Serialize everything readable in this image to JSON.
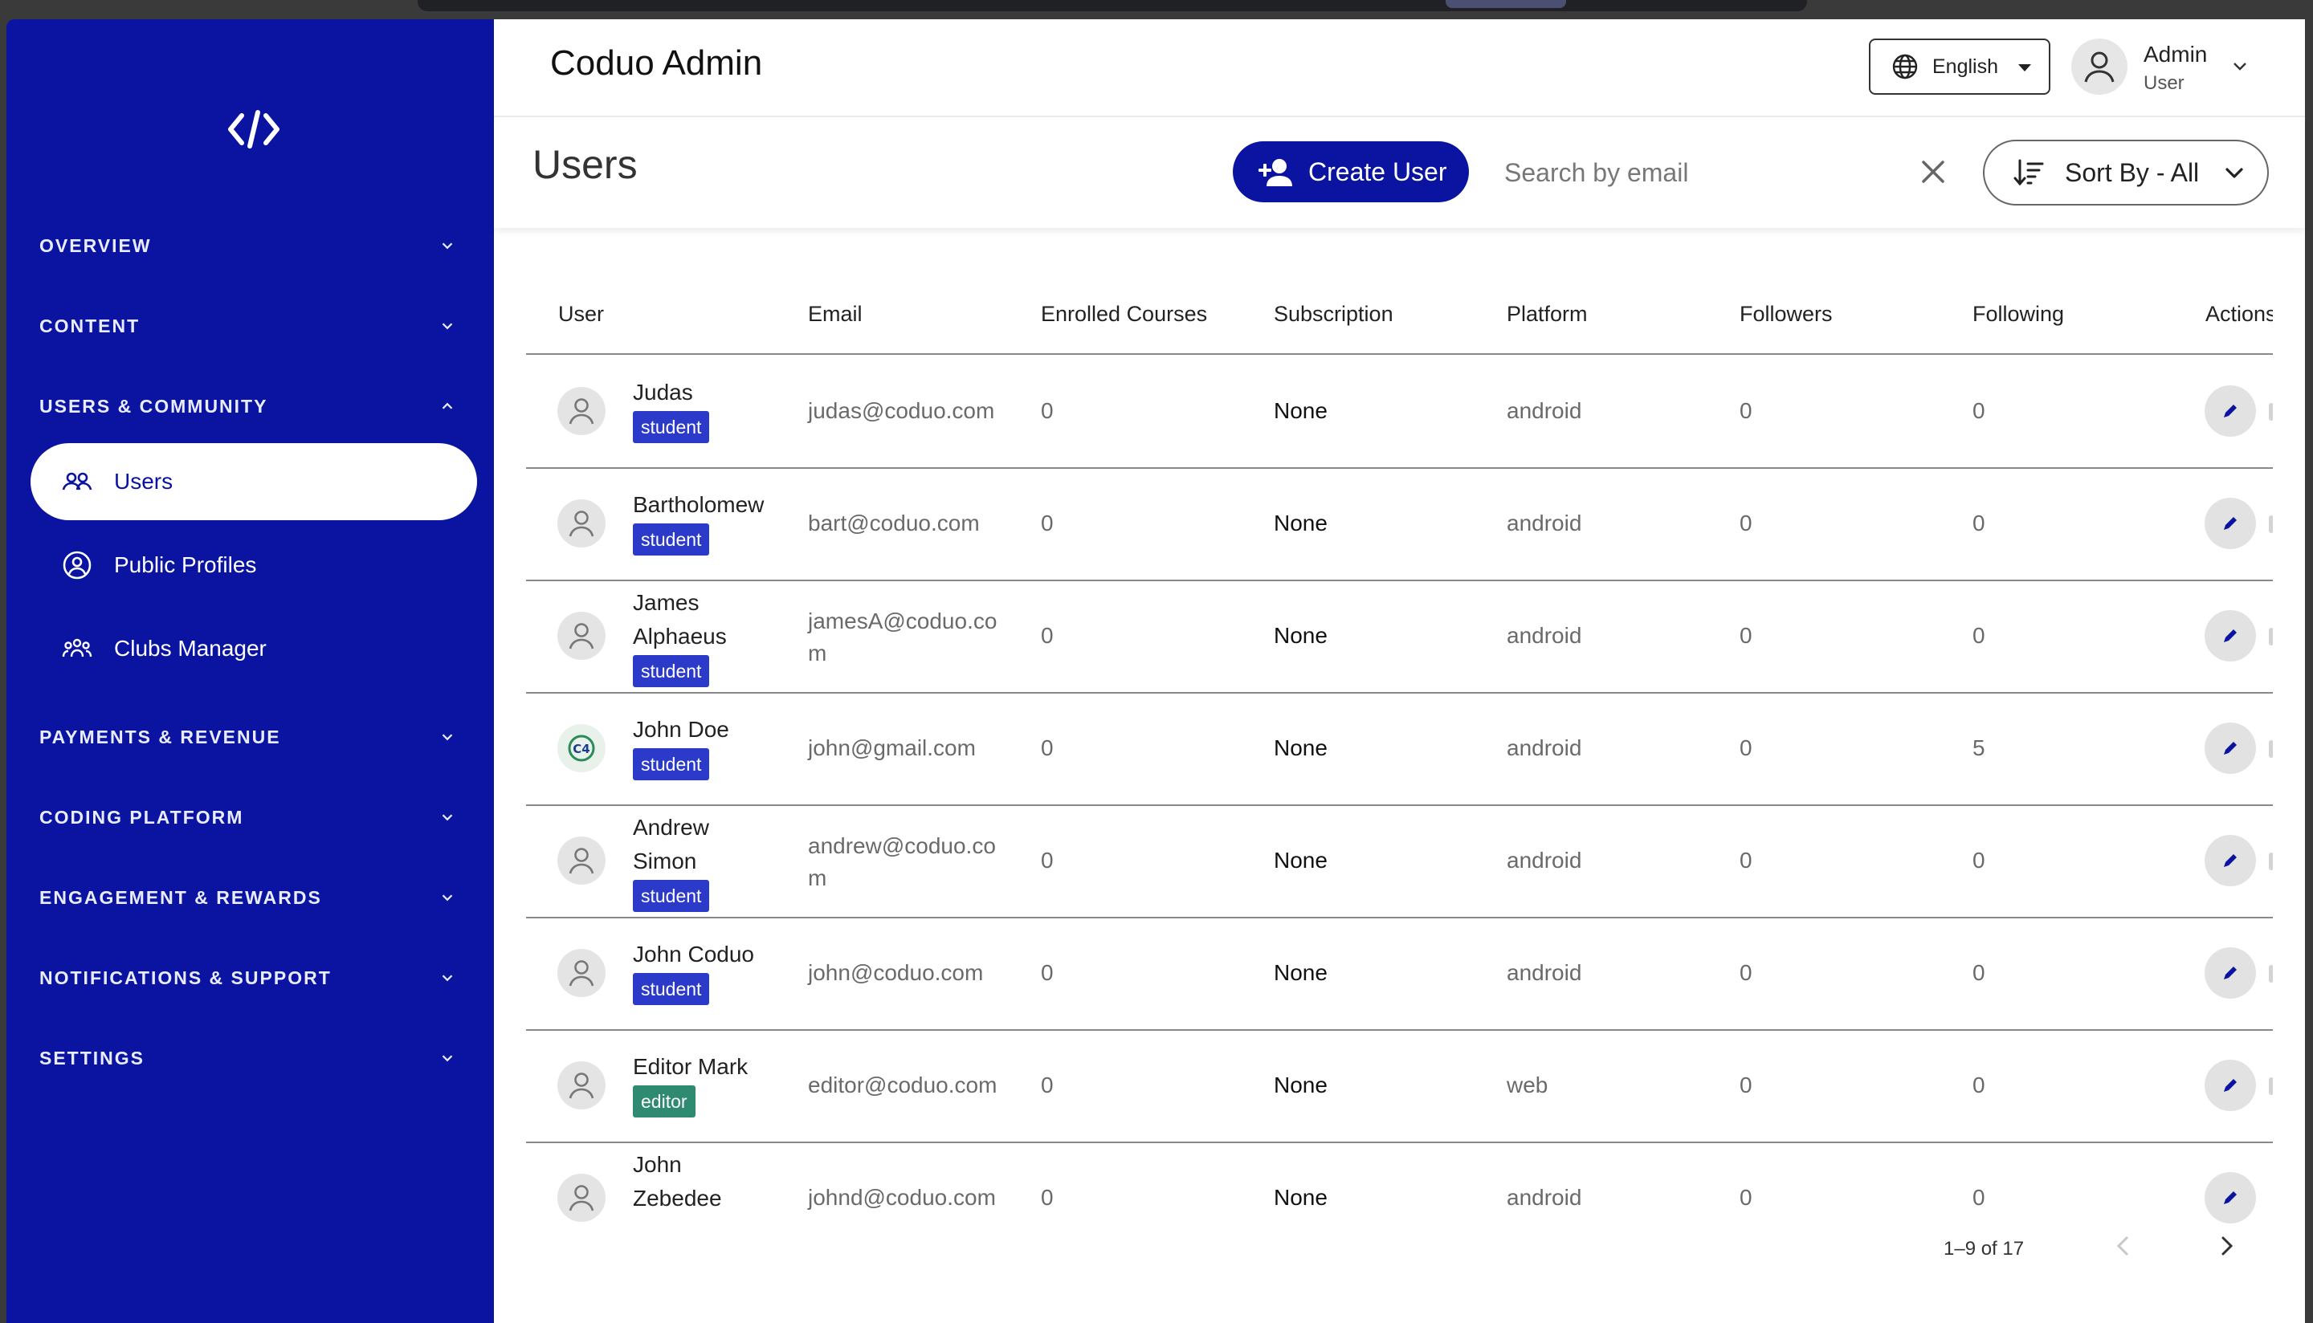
{
  "app": {
    "title": "Coduo Admin"
  },
  "header": {
    "language": "English",
    "user_name": "Admin",
    "user_role": "User"
  },
  "sidebar": {
    "logo_icon": "code-icon",
    "sections": [
      {
        "label": "OVERVIEW",
        "expanded": false
      },
      {
        "label": "CONTENT",
        "expanded": false
      },
      {
        "label": "USERS & COMMUNITY",
        "expanded": true
      },
      {
        "label": "PAYMENTS & REVENUE",
        "expanded": false
      },
      {
        "label": "CODING PLATFORM",
        "expanded": false
      },
      {
        "label": "ENGAGEMENT & REWARDS",
        "expanded": false
      },
      {
        "label": "NOTIFICATIONS & SUPPORT",
        "expanded": false
      },
      {
        "label": "SETTINGS",
        "expanded": false
      }
    ],
    "items": [
      {
        "label": "Users",
        "icon": "users-icon",
        "active": true
      },
      {
        "label": "Public Profiles",
        "icon": "profile-circle-icon",
        "active": false
      },
      {
        "label": "Clubs Manager",
        "icon": "groups-icon",
        "active": false
      }
    ]
  },
  "page": {
    "title": "Users",
    "create_label": "Create User",
    "search_placeholder": "Search by email",
    "search_value": "",
    "sort_label": "Sort By - All"
  },
  "table": {
    "columns": [
      "User",
      "Email",
      "Enrolled Courses",
      "Subscription",
      "Platform",
      "Followers",
      "Following",
      "Actions"
    ],
    "rows": [
      {
        "name": "Judas",
        "role": "student",
        "email": "judas@coduo.com",
        "enrolled": "0",
        "subscription": "None",
        "platform": "android",
        "followers": "0",
        "following": "0"
      },
      {
        "name": "Bartholomew",
        "role": "student",
        "email": "bart@coduo.com",
        "enrolled": "0",
        "subscription": "None",
        "platform": "android",
        "followers": "0",
        "following": "0"
      },
      {
        "name": "James Alphaeus",
        "role": "student",
        "email": "jamesA@coduo.com",
        "enrolled": "0",
        "subscription": "None",
        "platform": "android",
        "followers": "0",
        "following": "0"
      },
      {
        "name": "John Doe",
        "role": "student",
        "email": "john@gmail.com",
        "enrolled": "0",
        "subscription": "None",
        "platform": "android",
        "followers": "0",
        "following": "5"
      },
      {
        "name": "Andrew Simon",
        "role": "student",
        "email": "andrew@coduo.com",
        "enrolled": "0",
        "subscription": "None",
        "platform": "android",
        "followers": "0",
        "following": "0"
      },
      {
        "name": "John Coduo",
        "role": "student",
        "email": "john@coduo.com",
        "enrolled": "0",
        "subscription": "None",
        "platform": "android",
        "followers": "0",
        "following": "0"
      },
      {
        "name": "Editor Mark",
        "role": "editor",
        "email": "editor@coduo.com",
        "enrolled": "0",
        "subscription": "None",
        "platform": "web",
        "followers": "0",
        "following": "0"
      },
      {
        "name": "John Zebedee",
        "role": "",
        "email": "johnd@coduo.com",
        "enrolled": "0",
        "subscription": "None",
        "platform": "android",
        "followers": "0",
        "following": "0"
      }
    ]
  },
  "pagination": {
    "range": "1–9 of 17"
  }
}
